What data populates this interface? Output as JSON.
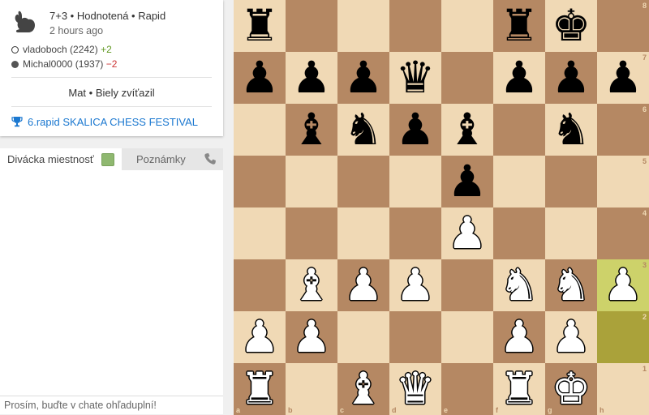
{
  "game": {
    "meta": "7+3 • Hodnotená • Rapid",
    "time_ago": "2 hours ago",
    "status": "Mat • Biely zvíťazil",
    "tournament": "6.rapid SKALICA CHESS FESTIVAL",
    "players": [
      {
        "color": "white",
        "name": "vladoboch (2242)",
        "diff": "+2"
      },
      {
        "color": "black",
        "name": "Michal0000 (1937)",
        "diff": "−2"
      }
    ]
  },
  "tabs": {
    "chat": "Divácka miestnosť",
    "notes": "Poznámky"
  },
  "chat": {
    "placeholder": "Prosím, buďte v chate ohľaduplní!"
  },
  "icons": {
    "variant": "rabbit-icon",
    "tournament": "trophy-icon",
    "call": "phone-icon",
    "chat_toggle": "checkbox-icon"
  },
  "colors": {
    "light_square": "#f0d9b5",
    "dark_square": "#b58863",
    "last_move_light": "#cdd26a",
    "last_move_dark": "#aaa23a",
    "link": "#1b78d0",
    "rating_up": "#629924",
    "rating_down": "#cc3333"
  },
  "board": {
    "files": [
      "a",
      "b",
      "c",
      "d",
      "e",
      "f",
      "g",
      "h"
    ],
    "ranks": [
      "8",
      "7",
      "6",
      "5",
      "4",
      "3",
      "2",
      "1"
    ],
    "last_move": [
      "h2",
      "h3"
    ],
    "pieces": [
      {
        "sq": "a8",
        "p": "r"
      },
      {
        "sq": "f8",
        "p": "r"
      },
      {
        "sq": "g8",
        "p": "k"
      },
      {
        "sq": "a7",
        "p": "p"
      },
      {
        "sq": "b7",
        "p": "p"
      },
      {
        "sq": "c7",
        "p": "p"
      },
      {
        "sq": "d7",
        "p": "q"
      },
      {
        "sq": "f7",
        "p": "p"
      },
      {
        "sq": "g7",
        "p": "p"
      },
      {
        "sq": "h7",
        "p": "p"
      },
      {
        "sq": "b6",
        "p": "b"
      },
      {
        "sq": "c6",
        "p": "n"
      },
      {
        "sq": "d6",
        "p": "p"
      },
      {
        "sq": "e6",
        "p": "b"
      },
      {
        "sq": "g6",
        "p": "n"
      },
      {
        "sq": "e5",
        "p": "p"
      },
      {
        "sq": "e4",
        "p": "P"
      },
      {
        "sq": "b3",
        "p": "B"
      },
      {
        "sq": "c3",
        "p": "P"
      },
      {
        "sq": "d3",
        "p": "P"
      },
      {
        "sq": "f3",
        "p": "N"
      },
      {
        "sq": "g3",
        "p": "N"
      },
      {
        "sq": "h3",
        "p": "P"
      },
      {
        "sq": "a2",
        "p": "P"
      },
      {
        "sq": "b2",
        "p": "P"
      },
      {
        "sq": "f2",
        "p": "P"
      },
      {
        "sq": "g2",
        "p": "P"
      },
      {
        "sq": "a1",
        "p": "R"
      },
      {
        "sq": "c1",
        "p": "B"
      },
      {
        "sq": "d1",
        "p": "Q"
      },
      {
        "sq": "f1",
        "p": "R"
      },
      {
        "sq": "g1",
        "p": "K"
      }
    ]
  }
}
